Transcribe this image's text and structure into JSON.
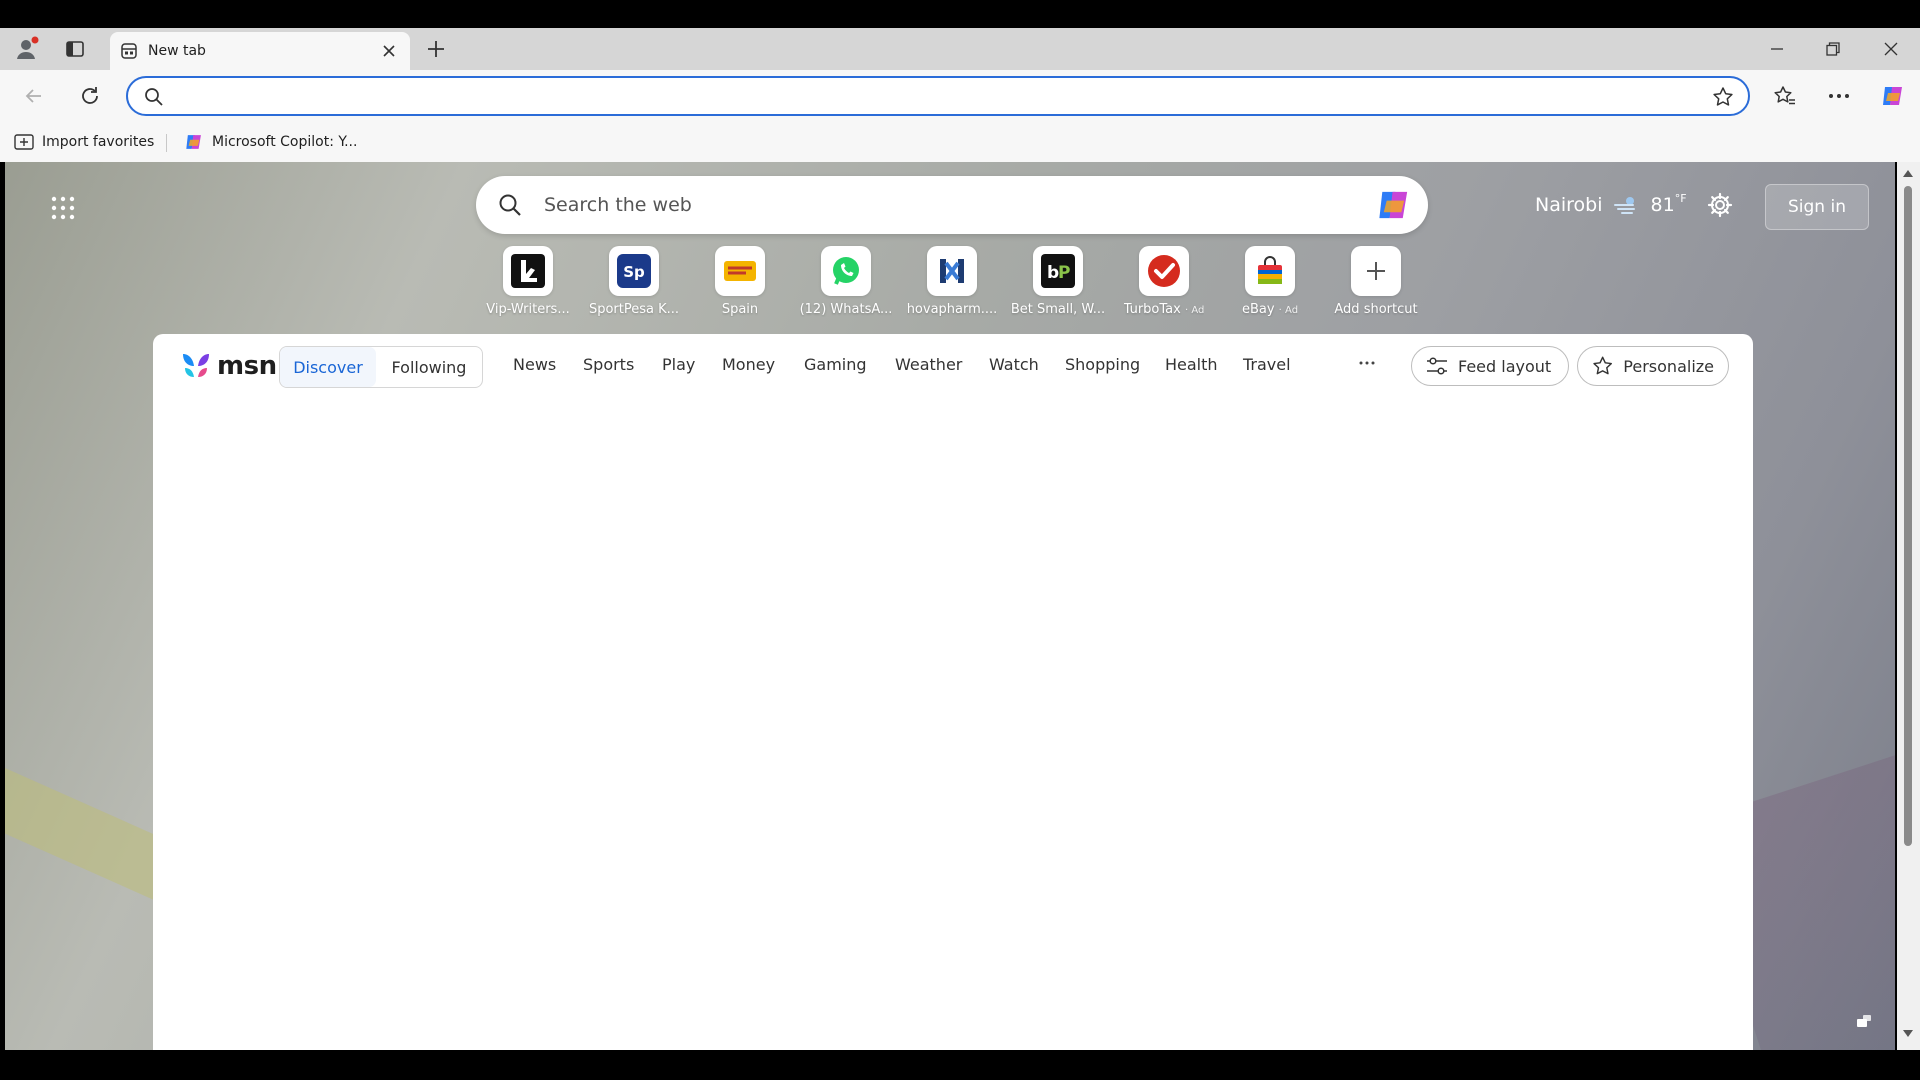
{
  "tab": {
    "title": "New tab"
  },
  "address_bar": {
    "value": "",
    "placeholder": ""
  },
  "favorites": {
    "import_label": "Import favorites",
    "copilot_label": "Microsoft Copilot: Y..."
  },
  "search": {
    "placeholder": "Search the web"
  },
  "weather": {
    "city": "Nairobi",
    "temperature": "81",
    "unit": "°F"
  },
  "signin_label": "Sign in",
  "shortcuts": [
    {
      "label": "Vip-Writers...",
      "ad": ""
    },
    {
      "label": "SportPesa K...",
      "ad": ""
    },
    {
      "label": "Spain",
      "ad": ""
    },
    {
      "label": "(12) WhatsA...",
      "ad": ""
    },
    {
      "label": "hovapharm....",
      "ad": ""
    },
    {
      "label": "Bet Small, W...",
      "ad": ""
    },
    {
      "label": "TurboTax",
      "ad": "· Ad"
    },
    {
      "label": "eBay",
      "ad": "· Ad"
    },
    {
      "label": "Add shortcut",
      "ad": ""
    }
  ],
  "feed": {
    "logo_text": "msn",
    "pills": [
      "Discover",
      "Following"
    ],
    "categories": [
      "News",
      "Sports",
      "Play",
      "Money",
      "Gaming",
      "Weather",
      "Watch",
      "Shopping",
      "Health",
      "Travel"
    ],
    "feed_layout_label": "Feed layout",
    "personalize_label": "Personalize"
  },
  "colors": {
    "accent": "#2b6cd8",
    "active_tab_text": "#1a66d6"
  }
}
